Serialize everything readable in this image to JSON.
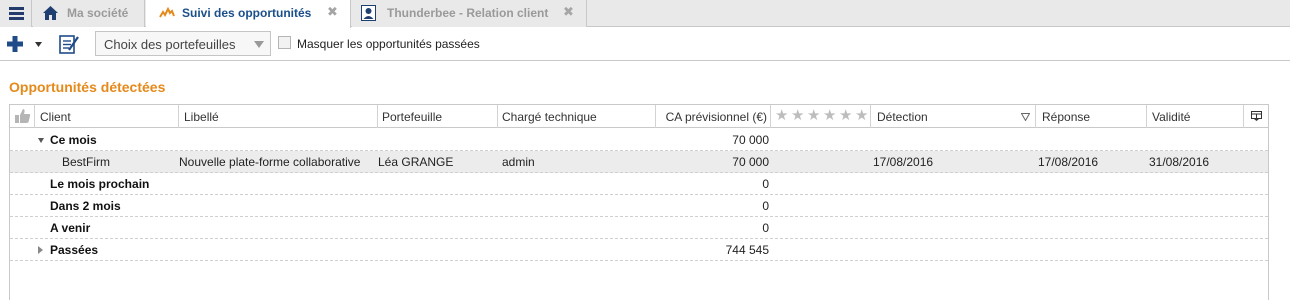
{
  "tabs": [
    {
      "label": "Ma société",
      "icon": "home-icon",
      "active": false
    },
    {
      "label": "Suivi des opportunités",
      "icon": "trend-icon",
      "active": true,
      "close": "✖"
    },
    {
      "label": "Thunderbee - Relation client",
      "icon": "contact-card-icon",
      "active": false,
      "close": "✖"
    }
  ],
  "toolbar": {
    "add_icon": "plus-icon",
    "edit_icon": "notepad-icon",
    "portfolio_select": "Choix des portefeuilles",
    "hide_past_label": "Masquer les opportunités passées",
    "hide_past_checked": false
  },
  "section": {
    "title": "Opportunités détectées"
  },
  "table": {
    "columns": {
      "client": "Client",
      "libelle": "Libellé",
      "portefeuille": "Portefeuille",
      "charge": "Chargé technique",
      "ca": "CA prévisionnel (€)",
      "detection": "Détection",
      "reponse": "Réponse",
      "validite": "Validité"
    },
    "rows": [
      {
        "type": "group",
        "expanded": true,
        "label": "Ce mois",
        "ca": "70 000"
      },
      {
        "type": "item",
        "client": "BestFirm",
        "libelle": "Nouvelle plate-forme collaborative",
        "portefeuille": "Léa GRANGE",
        "charge": "admin",
        "ca": "70 000",
        "detection": "17/08/2016",
        "reponse": "17/08/2016",
        "validite": "31/08/2016"
      },
      {
        "type": "group",
        "label": "Le mois prochain",
        "ca": "0"
      },
      {
        "type": "group",
        "label": "Dans 2 mois",
        "ca": "0"
      },
      {
        "type": "group",
        "label": "A venir",
        "ca": "0"
      },
      {
        "type": "group",
        "expanded": false,
        "label": "Passées",
        "ca": "744 545"
      }
    ]
  },
  "colors": {
    "accent": "#e58a1a",
    "tab_active_text": "#1a4f8a",
    "nav_icon": "#243c6d",
    "selected_row": "#ececec"
  }
}
